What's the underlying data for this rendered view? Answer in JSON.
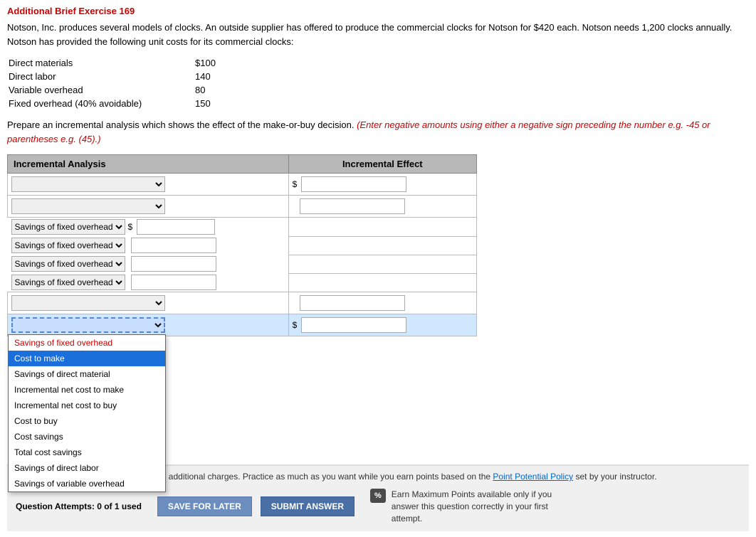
{
  "title": "Additional Brief Exercise 169",
  "problem": {
    "text": "Notson, Inc. produces several models of clocks. An outside supplier has offered to produce the commercial clocks for Notson for $420 each. Notson needs 1,200 clocks annually. Notson has provided the following unit costs for its commercial clocks:"
  },
  "costs": [
    {
      "label": "Direct materials",
      "value": "$100"
    },
    {
      "label": "Direct labor",
      "value": "140"
    },
    {
      "label": "Variable overhead",
      "value": "80"
    },
    {
      "label": "Fixed overhead (40% avoidable)",
      "value": "150"
    }
  ],
  "instruction": {
    "prefix": "Prepare an incremental analysis which shows the effect of the make-or-buy decision.",
    "italic": "(Enter negative amounts using either a negative sign preceding the number e.g. -45 or parentheses e.g. (45).)"
  },
  "table": {
    "col1_header": "Incremental Analysis",
    "col2_header": "Incremental Effect",
    "rows": [
      {
        "dropdown_value": "",
        "amount": "",
        "has_dollar": true,
        "col2_only": true
      },
      {
        "dropdown_value": "",
        "amount": "",
        "has_dollar": false,
        "col2_only": true
      },
      {
        "dropdown_value": "",
        "amount": "",
        "has_dollar": true,
        "col2_only": false
      },
      {
        "dropdown_value": "",
        "amount": "",
        "has_dollar": false,
        "col2_only": false
      },
      {
        "dropdown_value": "",
        "amount": "",
        "has_dollar": false,
        "col2_only": false
      },
      {
        "dropdown_value": "",
        "amount": "",
        "has_dollar": false,
        "col2_only": false
      },
      {
        "dropdown_value": "",
        "amount": "",
        "has_dollar": false,
        "col2_only": true
      },
      {
        "dropdown_value": "",
        "amount": "",
        "has_dollar": true,
        "col2_only": false,
        "active": true
      }
    ],
    "dropdown_options": [
      "Savings of fixed overhead",
      "Cost to make",
      "Savings of direct material",
      "Incremental net cost to make",
      "Incremental net cost to buy",
      "Cost to buy",
      "Cost savings",
      "Total cost savings",
      "Savings of direct labor",
      "Savings of variable overhead"
    ]
  },
  "bottom": {
    "policy_text": "By accessing this question you agree to additional charges. Practice as much as you want while you earn points based on the Point Potential Policy set by your instructor.",
    "attempts_label": "Question Attempts: 0 of 1 used",
    "save_label": "SAVE FOR LATER",
    "submit_label": "SUBMIT ANSWER",
    "percent_badge": "%",
    "earn_text": "Earn Maximum Points available only if you answer this question correctly in your first attempt."
  },
  "dropdown_open": {
    "selected_index": -1,
    "items": [
      "Savings of fixed overhead",
      "Cost to make",
      "Savings of direct material",
      "Incremental net cost to make",
      "Incremental net cost to buy",
      "Cost to buy",
      "Cost savings",
      "Total cost savings",
      "Savings of direct labor",
      "Savings of variable overhead"
    ]
  }
}
